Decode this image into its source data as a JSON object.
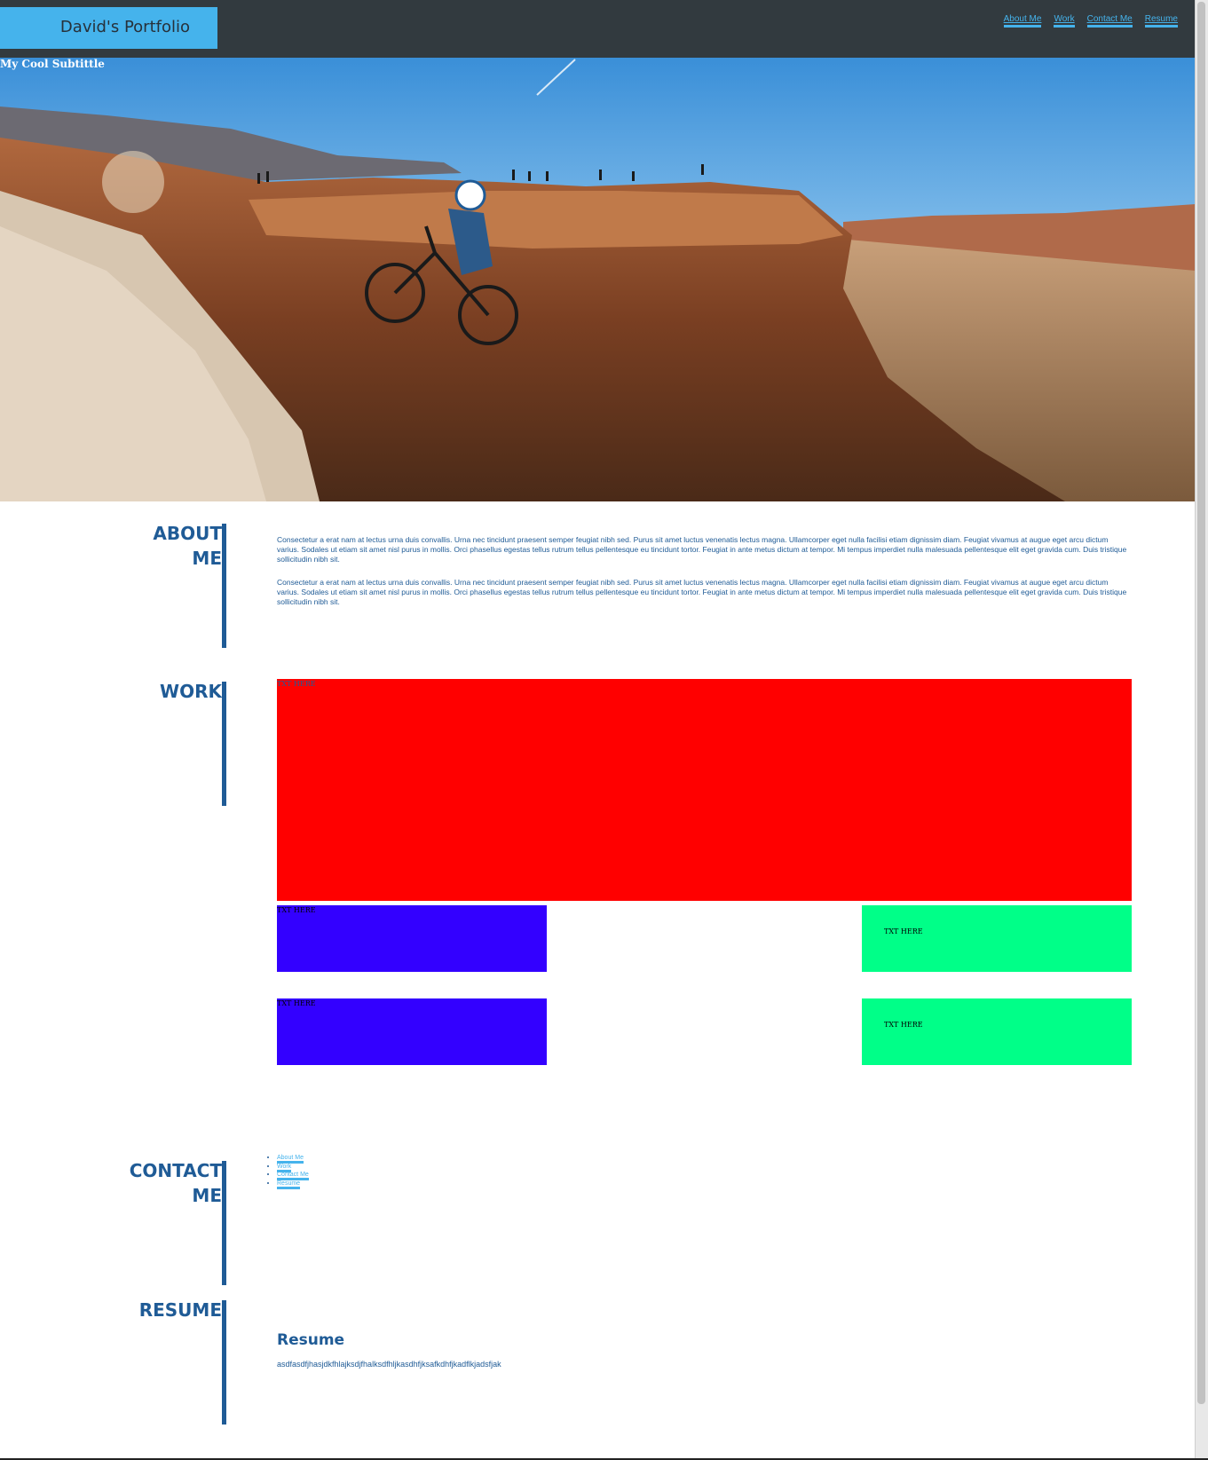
{
  "header": {
    "brand": "David's Portfolio",
    "nav": [
      "About Me",
      "Work",
      "Contact Me",
      "Resume"
    ]
  },
  "hero": {
    "subtitle": "My Cool Subtittle",
    "image_desc": "mountain-biker-canyon-photo"
  },
  "about": {
    "heading_line1": "ABOUT",
    "heading_line2": "ME",
    "paragraph1": "Consectetur a erat nam at lectus urna duis convallis. Urna nec tincidunt praesent semper feugiat nibh sed. Purus sit amet luctus venenatis lectus magna. Ullamcorper eget nulla facilisi etiam dignissim diam. Feugiat vivamus at augue eget arcu dictum varius. Sodales ut etiam sit amet nisl purus in mollis. Orci phasellus egestas tellus rutrum tellus pellentesque eu tincidunt tortor. Feugiat in ante metus dictum at tempor. Mi tempus imperdiet nulla malesuada pellentesque elit eget gravida cum. Duis tristique sollicitudin nibh sit.",
    "paragraph2": "Consectetur a erat nam at lectus urna duis convallis. Urna nec tincidunt praesent semper feugiat nibh sed. Purus sit amet luctus venenatis lectus magna. Ullamcorper eget nulla facilisi etiam dignissim diam. Feugiat vivamus at augue eget arcu dictum varius. Sodales ut etiam sit amet nisl purus in mollis. Orci phasellus egestas tellus rutrum tellus pellentesque eu tincidunt tortor. Feugiat in ante metus dictum at tempor. Mi tempus imperdiet nulla malesuada pellentesque elit eget gravida cum. Duis tristique sollicitudin nibh sit."
  },
  "work": {
    "heading": "WORK",
    "tiles": [
      {
        "label": "TXT HERE",
        "color": "#ff0000"
      },
      {
        "label": "TXT HERE",
        "color": "#3300ff"
      },
      {
        "label": "TXT HERE",
        "color": "#00ff88"
      },
      {
        "label": "TXT HERE",
        "color": "#3300ff"
      },
      {
        "label": "TXT HERE",
        "color": "#00ff88"
      }
    ]
  },
  "contact": {
    "heading_line1": "CONTACT",
    "heading_line2": "ME",
    "links": [
      "About Me",
      "Work",
      "Contact Me",
      "Resume"
    ]
  },
  "resume": {
    "heading": "RESUME",
    "title": "Resume",
    "body": "asdfasdfjhasjdkfhlajksdjfhalksdfhljkasdhfjksafkdhfjkadflkjadsfjak"
  },
  "colors": {
    "topbar": "#323a3f",
    "brand_bg": "#45b3ec",
    "accent_blue": "#1f5b96",
    "link_blue": "#45b3ec"
  }
}
